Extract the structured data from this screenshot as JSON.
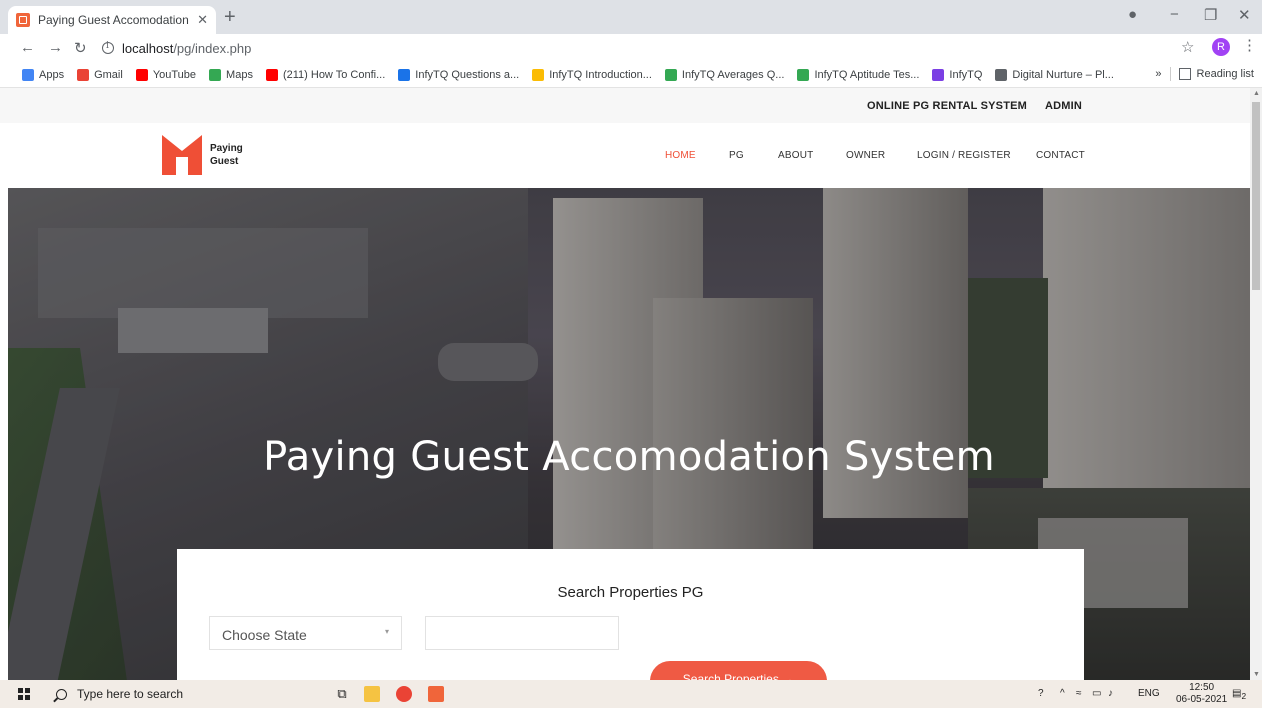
{
  "browser": {
    "tab_title": "Paying Guest Accomodation Syst",
    "url_host": "localhost",
    "url_path": "/pg/index.php",
    "profile_initial": "R",
    "bookmarks": [
      {
        "label": "Apps",
        "color": "#4285f4"
      },
      {
        "label": "Gmail",
        "color": "#ea4335"
      },
      {
        "label": "YouTube",
        "color": "#ff0000"
      },
      {
        "label": "Maps",
        "color": "#34a853"
      },
      {
        "label": "(211) How To Confi...",
        "color": "#ff0000"
      },
      {
        "label": "InfyTQ Questions a...",
        "color": "#1a73e8"
      },
      {
        "label": "InfyTQ Introduction...",
        "color": "#fbbc04"
      },
      {
        "label": "InfyTQ Averages Q...",
        "color": "#34a853"
      },
      {
        "label": "InfyTQ Aptitude Tes...",
        "color": "#34a853"
      },
      {
        "label": "InfyTQ",
        "color": "#7b3fe4"
      },
      {
        "label": "Digital Nurture – Pl...",
        "color": "#5f6368"
      }
    ],
    "more_bookmarks": "»",
    "reading_list": "Reading list"
  },
  "site": {
    "topbar": {
      "rental_link": "ONLINE PG RENTAL SYSTEM",
      "admin_link": "ADMIN"
    },
    "logo": {
      "line1": "Paying",
      "line2": "Guest"
    },
    "nav": {
      "home": "HOME",
      "pg": "PG",
      "about": "ABOUT",
      "owner": "OWNER",
      "login": "LOGIN / REGISTER",
      "contact": "CONTACT"
    },
    "hero_title": "Paying Guest Accomodation System",
    "search": {
      "heading": "Search Properties PG",
      "state_select": "Choose State",
      "button": "Search Properties →"
    }
  },
  "taskbar": {
    "search_placeholder": "Type here to search",
    "language": "ENG",
    "time": "12:50",
    "date": "06-05-2021",
    "notification_count": "2"
  },
  "colors": {
    "accent": "#ef4f36",
    "button": "#ef5a44"
  }
}
